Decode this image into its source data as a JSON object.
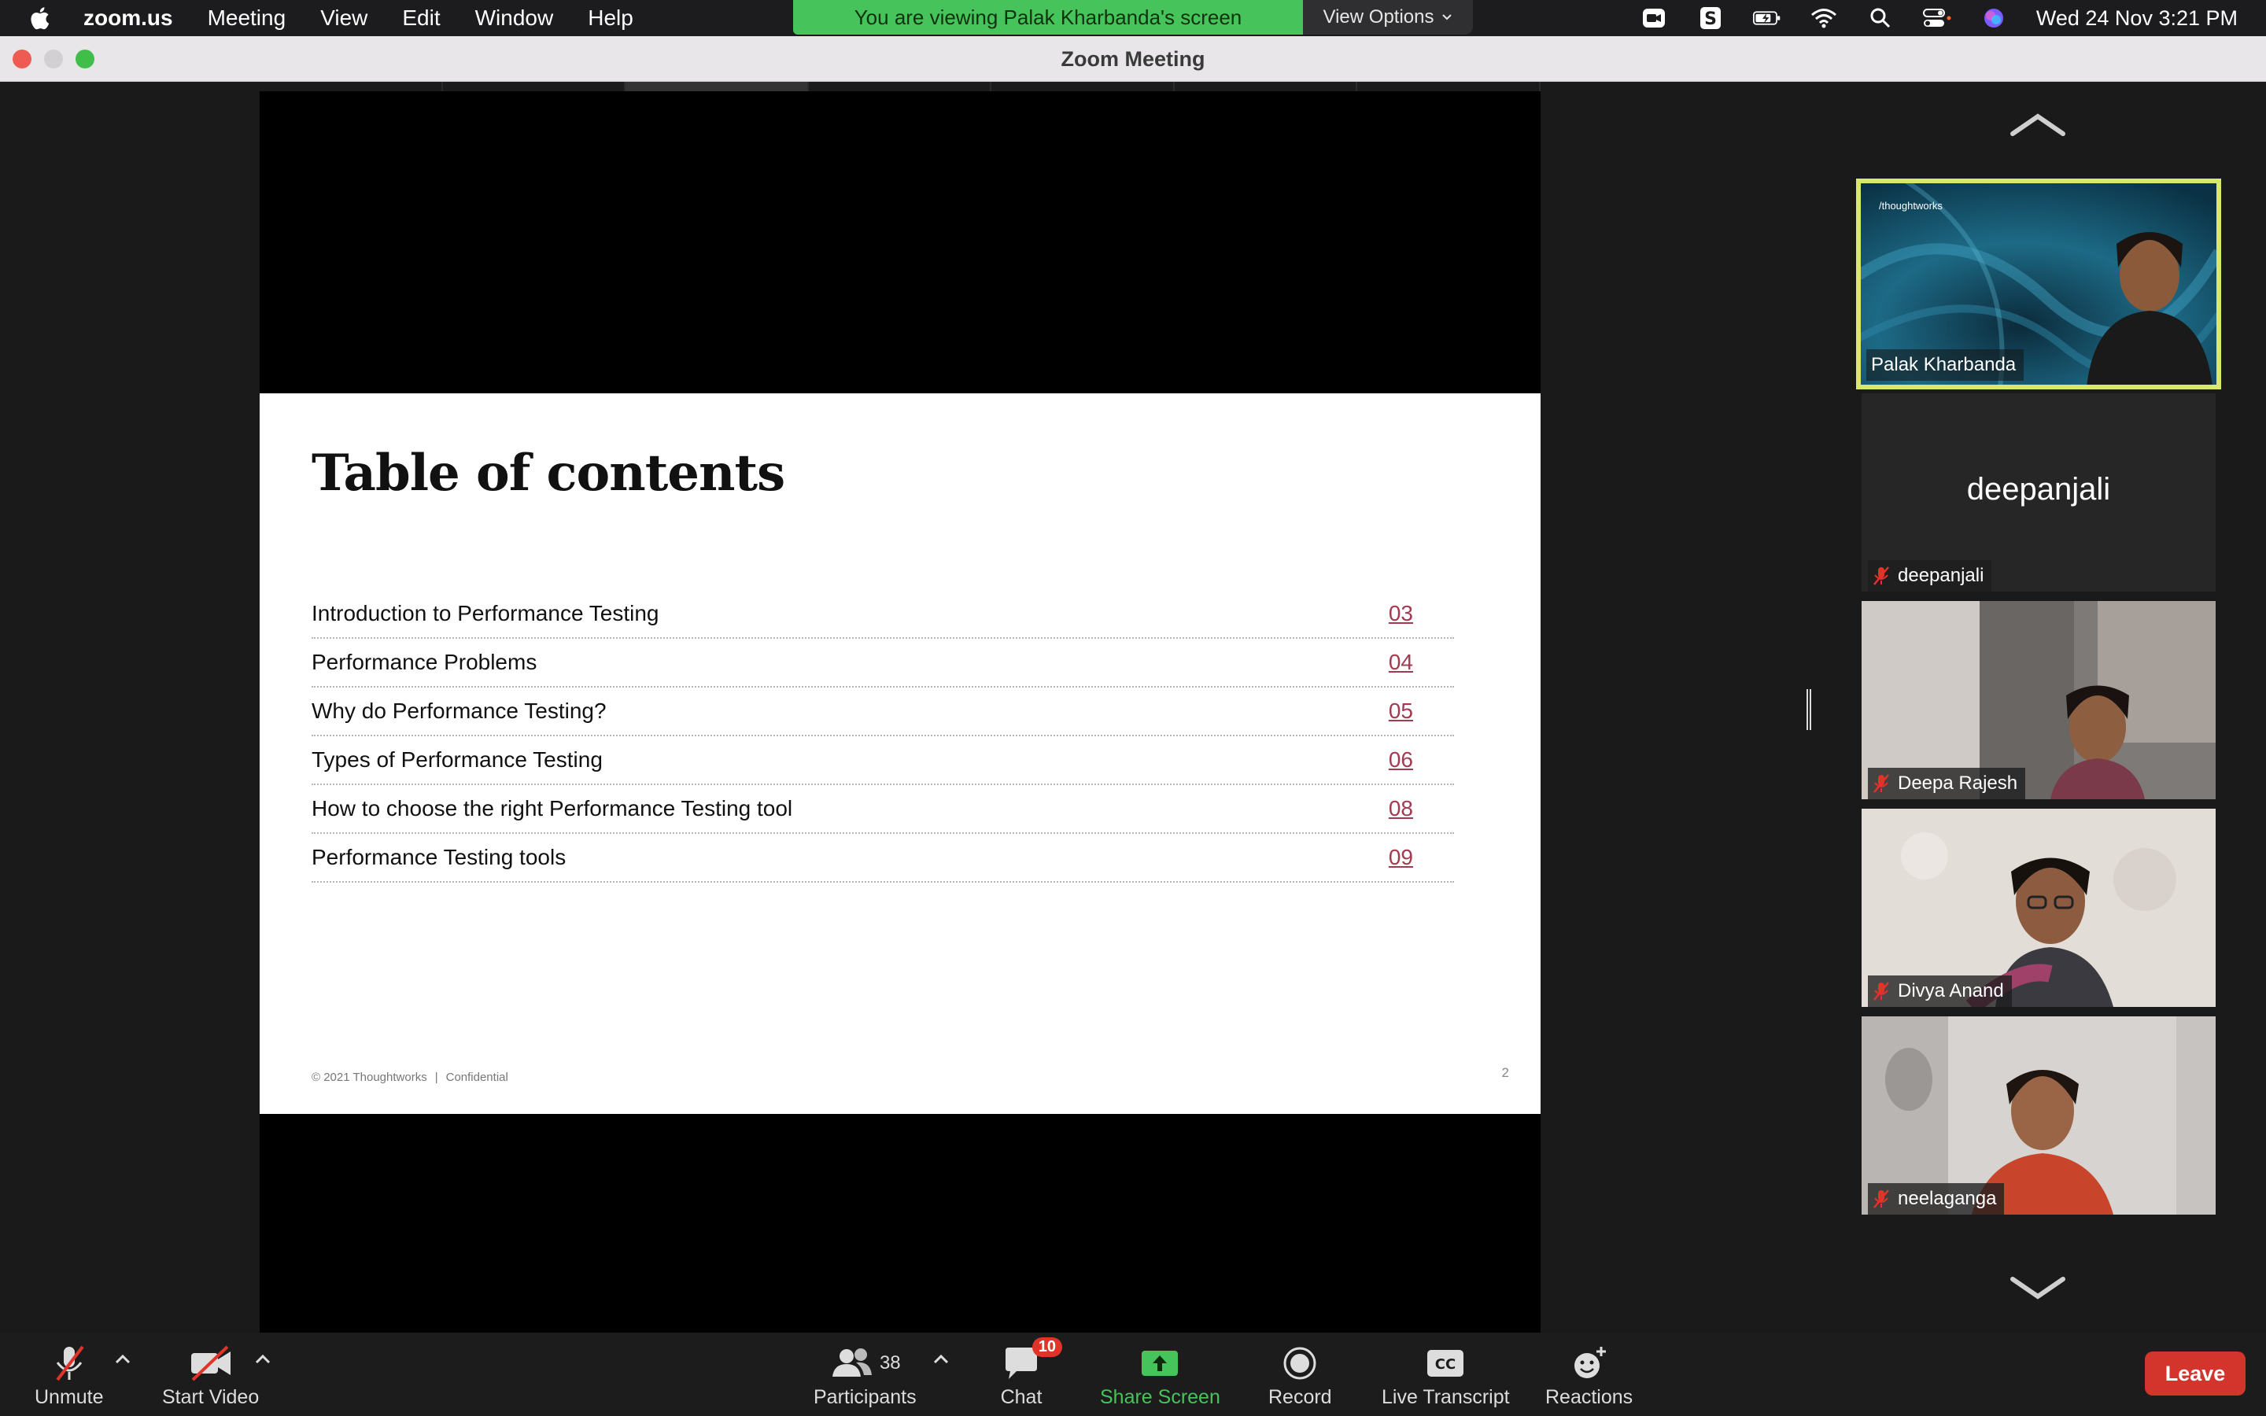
{
  "menubar": {
    "app_name": "zoom.us",
    "menus": [
      "Meeting",
      "View",
      "Edit",
      "Window",
      "Help"
    ],
    "share_banner": "You are viewing Palak Kharbanda's screen",
    "view_options": "View Options",
    "clock": "Wed 24 Nov  3:21 PM"
  },
  "window": {
    "title": "Zoom Meeting"
  },
  "slide": {
    "title": "Table of contents",
    "toc": [
      {
        "label": "Introduction to Performance Testing",
        "page": "03"
      },
      {
        "label": "Performance Problems",
        "page": "04"
      },
      {
        "label": "Why do Performance Testing?",
        "page": "05"
      },
      {
        "label": "Types of Performance Testing",
        "page": "06"
      },
      {
        "label": "How to choose the right Performance Testing tool",
        "page": "08"
      },
      {
        "label": "Performance Testing tools",
        "page": "09"
      }
    ],
    "footer_copyright": "© 2021 Thoughtworks",
    "footer_confidential": "Confidential",
    "page_number": "2"
  },
  "gallery": {
    "tiles": [
      {
        "name": "Palak Kharbanda",
        "overlay_text": "/thoughtworks"
      },
      {
        "name": "deepanjali",
        "display_name": "deepanjali"
      },
      {
        "name": "Deepa Rajesh"
      },
      {
        "name": "Divya Anand"
      },
      {
        "name": "neelaganga"
      }
    ]
  },
  "toolbar": {
    "unmute": "Unmute",
    "start_video": "Start Video",
    "participants": "Participants",
    "participant_count": "38",
    "chat": "Chat",
    "chat_badge": "10",
    "share_screen": "Share Screen",
    "record": "Record",
    "live_transcript": "Live Transcript",
    "cc_label": "CC",
    "reactions": "Reactions",
    "leave": "Leave"
  },
  "colors": {
    "share_banner": "#46c35a",
    "active_speaker_border": "#d8e86a",
    "leave": "#d3352d",
    "toc_link": "#a23a50"
  }
}
